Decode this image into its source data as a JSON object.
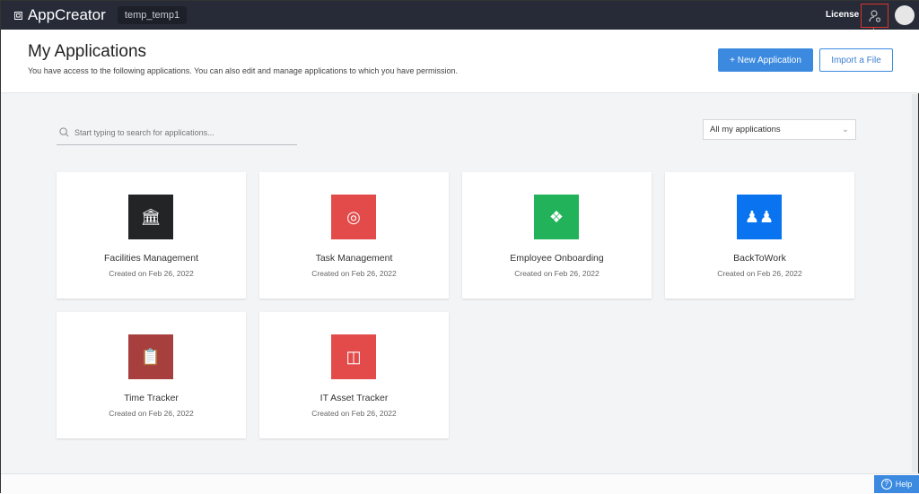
{
  "topbar": {
    "app_name": "AppCreator",
    "workspace": "temp_temp1",
    "license": "License"
  },
  "header": {
    "title": "My Applications",
    "subtitle": "You have access to the following applications. You can also edit and manage applications to which you have permission.",
    "new_app": "New Application",
    "import": "Import a File"
  },
  "search": {
    "placeholder": "Start typing to search for applications..."
  },
  "filter": {
    "selected": "All my applications"
  },
  "apps": [
    {
      "name": "Facilities Management",
      "created": "Created on Feb 26, 2022",
      "color": "#222426",
      "icon": "bank-icon"
    },
    {
      "name": "Task Management",
      "created": "Created on Feb 26, 2022",
      "color": "#e24b4a",
      "icon": "target-icon"
    },
    {
      "name": "Employee Onboarding",
      "created": "Created on Feb 26, 2022",
      "color": "#22b35a",
      "icon": "network-icon"
    },
    {
      "name": "BackToWork",
      "created": "Created on Feb 26, 2022",
      "color": "#0a74f0",
      "icon": "team-icon"
    },
    {
      "name": "Time Tracker",
      "created": "Created on Feb 26, 2022",
      "color": "#a83f3f",
      "icon": "clipboard-clock-icon"
    },
    {
      "name": "IT Asset Tracker",
      "created": "Created on Feb 26, 2022",
      "color": "#e24b4a",
      "icon": "devices-icon"
    }
  ],
  "help": "Help"
}
